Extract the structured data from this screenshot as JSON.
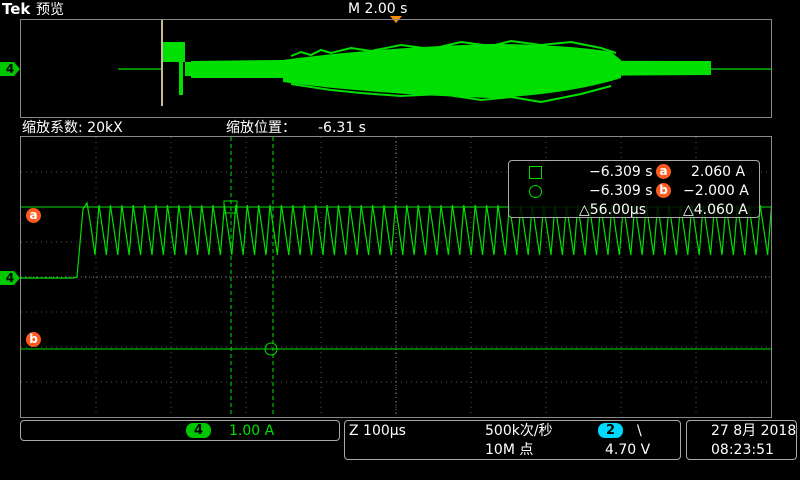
{
  "header": {
    "brand": "Tek",
    "mode": "预览",
    "timebase": "M 2.00 s"
  },
  "zoom": {
    "factor_label": "缩放系数: 20kX",
    "position_label": "缩放位置：",
    "position_value": "-6.31 s"
  },
  "markers": {
    "ch4": "4",
    "a": "a",
    "b": "b"
  },
  "cursor_readout": {
    "square_time": "−6.309 s",
    "circle_time": "−6.309 s",
    "delta_time": "△56.00µs",
    "a_value": "2.060 A",
    "b_value": "−2.000 A",
    "delta_value": "△4.060 A"
  },
  "channel_box": {
    "channel": "4",
    "scale": "1.00 A"
  },
  "horizontal_box": {
    "zoom_scale": "Z 100µs",
    "sample_rate": "500k次/秒",
    "record_length": "10M 点",
    "trigger_channel": "2",
    "trigger_slope": "\\",
    "trigger_level": "4.70 V"
  },
  "datetime": {
    "date": "27 8月 2018",
    "time": "08:23:51"
  },
  "colors": {
    "ch4": "#00e000",
    "ch2": "#00d8ff",
    "cursor_badge": "#ff5a1e",
    "trigger_marker": "#ff8c00"
  }
}
